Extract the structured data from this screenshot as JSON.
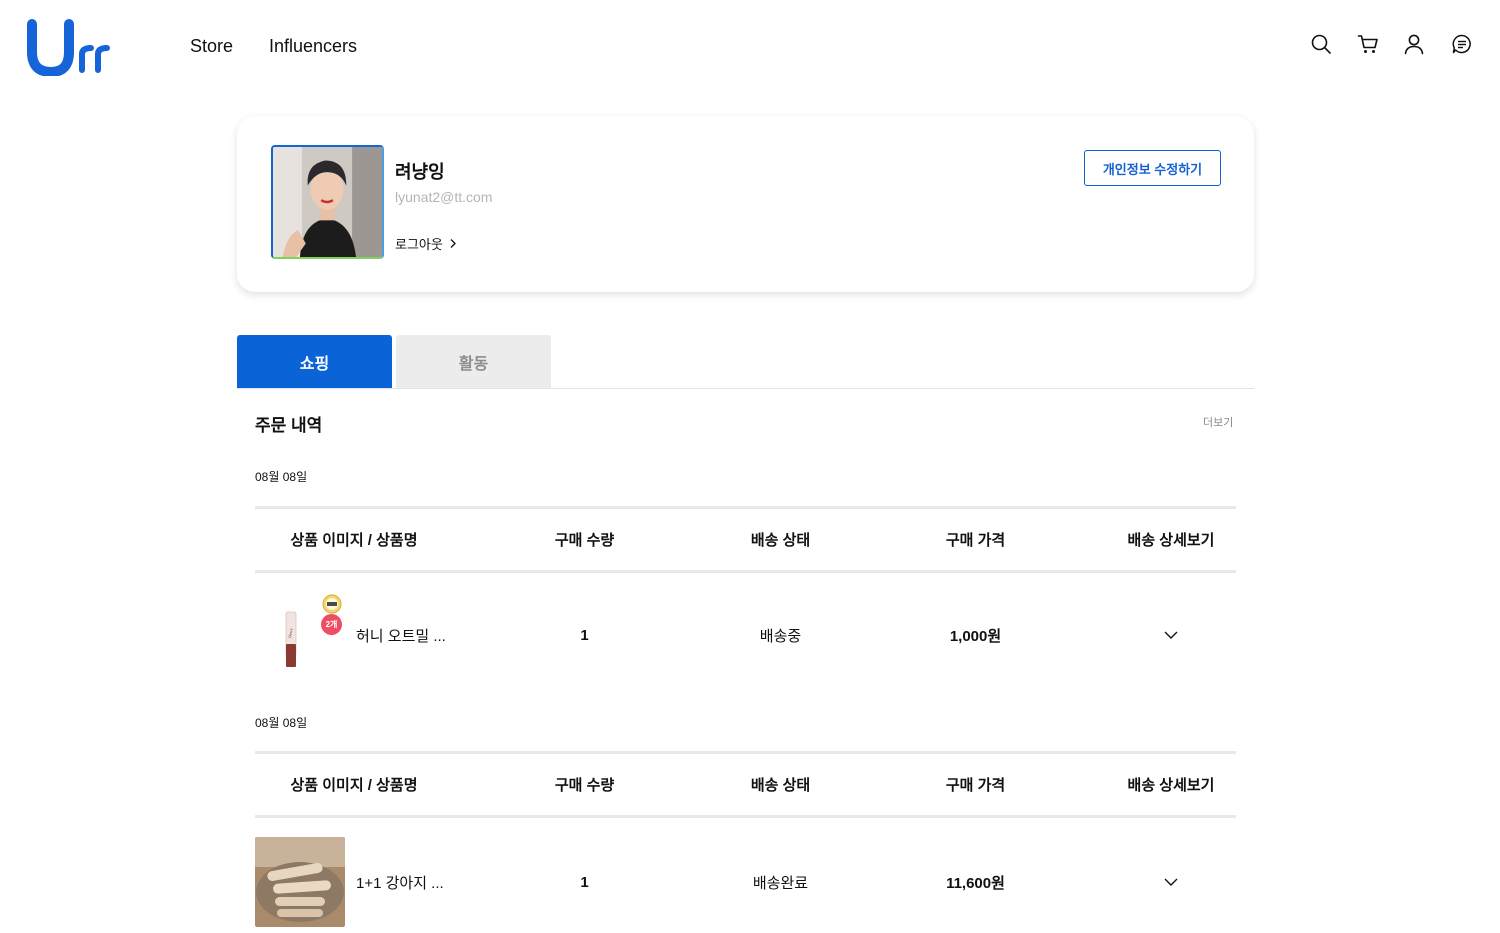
{
  "brand": {
    "logo_text": "Urr",
    "color": "#1565d8"
  },
  "nav": {
    "store": "Store",
    "influencers": "Influencers"
  },
  "header_icons": [
    "search-icon",
    "cart-icon",
    "user-icon",
    "chat-icon"
  ],
  "profile": {
    "name": "려냥잉",
    "email": "lyunat2@tt.com",
    "logout": "로그아웃",
    "edit_button": "개인정보 수정하기"
  },
  "tabs": [
    {
      "label": "쇼핑",
      "active": true
    },
    {
      "label": "활동",
      "active": false
    }
  ],
  "orders": {
    "title": "주문 내역",
    "more": "더보기",
    "columns": [
      "상품 이미지 / 상품명",
      "구매 수량",
      "배송 상태",
      "구매 가격",
      "배송 상세보기"
    ],
    "groups": [
      {
        "date": "08월 08일",
        "product": "허니 오트밀 ...",
        "quantity": "1",
        "status": "배송중",
        "price": "1,000원",
        "thumbnail": "lip-tint-product",
        "badge": "2개"
      },
      {
        "date": "08월 08일",
        "product": "1+1 강아지 ...",
        "quantity": "1",
        "status": "배송완료",
        "price": "11,600원",
        "thumbnail": "dog-treat-product"
      }
    ]
  },
  "colors": {
    "accent": "#0b63d8",
    "inactive_tab": "#ececec",
    "divider": "#e9e9e9"
  }
}
